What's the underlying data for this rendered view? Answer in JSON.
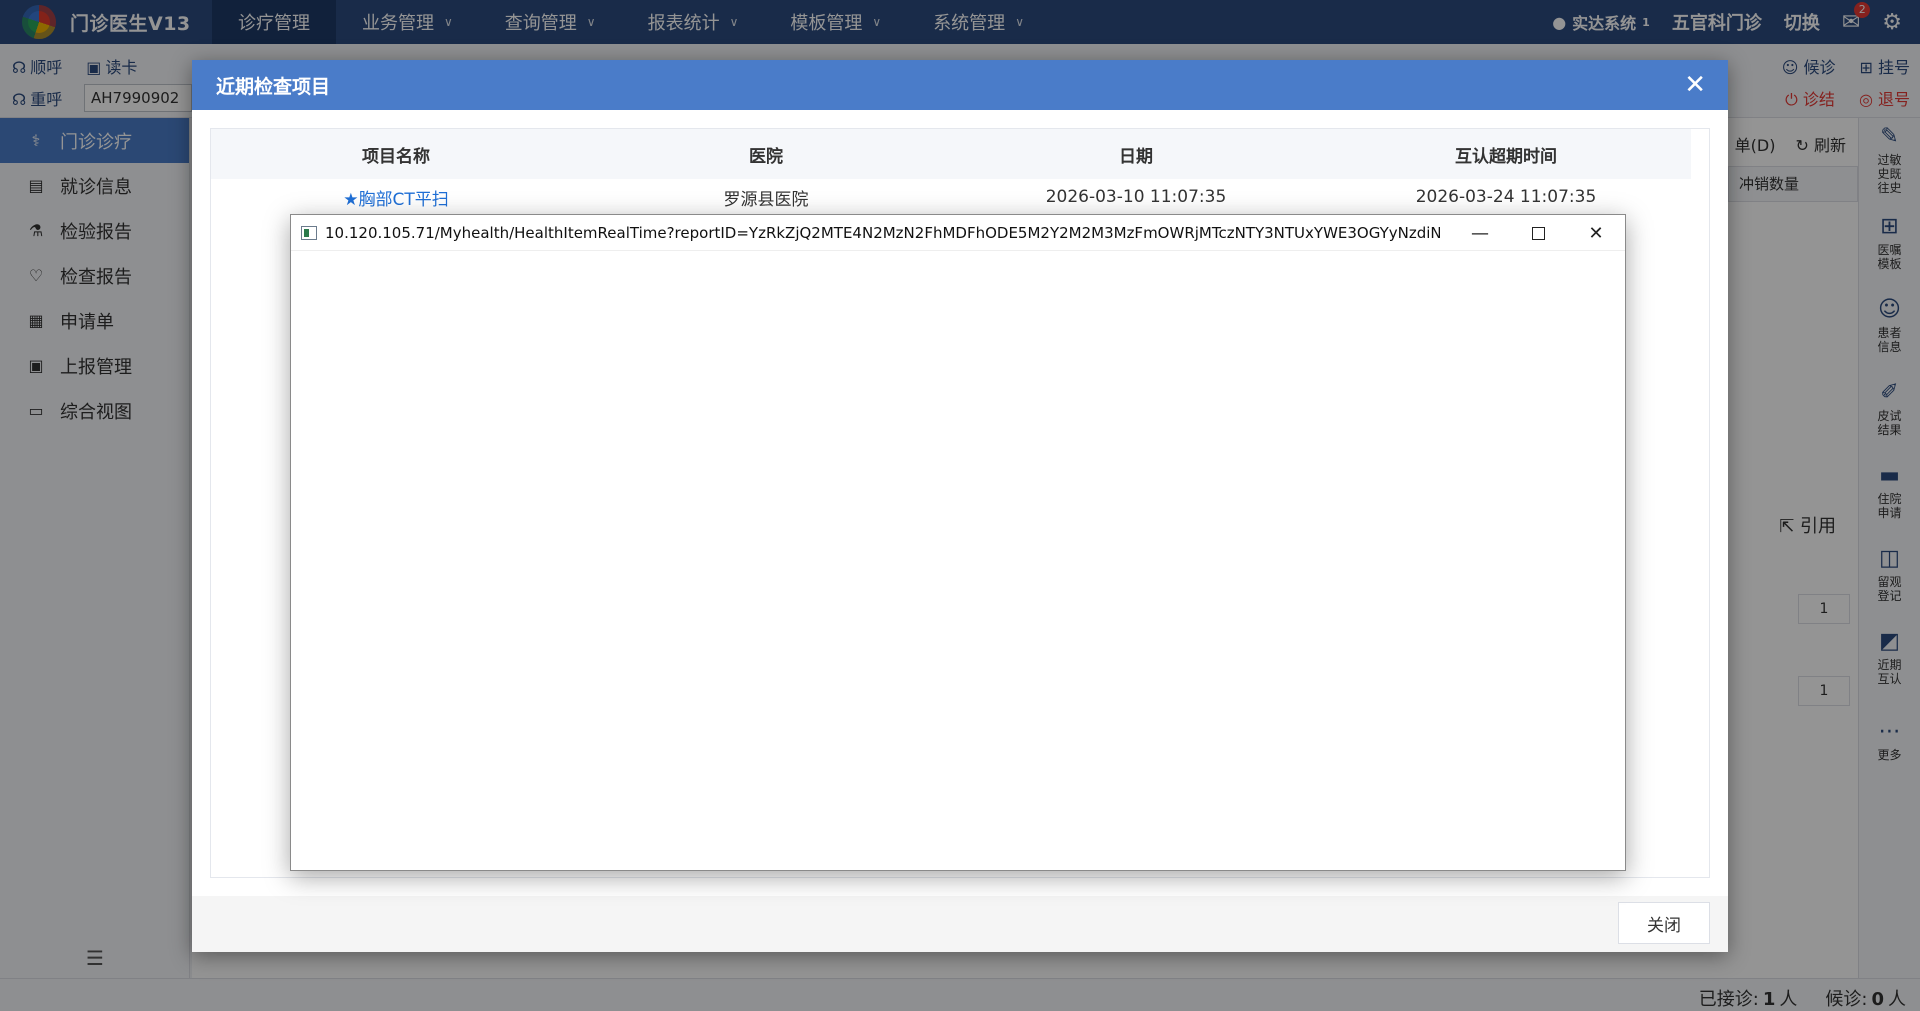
{
  "app": {
    "title": "门诊医生V13",
    "nav": [
      {
        "label": "诊疗管理",
        "active": true,
        "has_menu": false
      },
      {
        "label": "业务管理",
        "active": false,
        "has_menu": true
      },
      {
        "label": "查询管理",
        "active": false,
        "has_menu": true
      },
      {
        "label": "报表统计",
        "active": false,
        "has_menu": true
      },
      {
        "label": "模板管理",
        "active": false,
        "has_menu": true
      },
      {
        "label": "系统管理",
        "active": false,
        "has_menu": true
      }
    ],
    "user": "实达系统",
    "user_sub": "1",
    "department": "五官科门诊",
    "switch_label": "切换",
    "mail_count": "2"
  },
  "toolbar": {
    "call_label": "顺呼",
    "read_card_label": "读卡",
    "recall_label": "重呼",
    "patient_id": "AH7990902",
    "wait_label": "候诊",
    "register_label": "挂号",
    "finish_label": "诊结",
    "refund_label": "退号"
  },
  "sidebar": {
    "items": [
      {
        "label": "门诊诊疗",
        "icon": "stethoscope-icon",
        "glyph": "⚕",
        "active": true
      },
      {
        "label": "就诊信息",
        "icon": "id-card-icon",
        "glyph": "▤",
        "active": false
      },
      {
        "label": "检验报告",
        "icon": "flask-icon",
        "glyph": "⚗",
        "active": false
      },
      {
        "label": "检查报告",
        "icon": "heart-pulse-icon",
        "glyph": "♡",
        "active": false
      },
      {
        "label": "申请单",
        "icon": "form-icon",
        "glyph": "▦",
        "active": false
      },
      {
        "label": "上报管理",
        "icon": "clipboard-icon",
        "glyph": "▣",
        "active": false
      },
      {
        "label": "综合视图",
        "icon": "dashboard-icon",
        "glyph": "▭",
        "active": false
      }
    ]
  },
  "right_sidebar": {
    "items": [
      {
        "label": "过敏史既往史",
        "icon": "capsule-icon",
        "glyph": "✎"
      },
      {
        "label": "医嘱模板",
        "icon": "template-icon",
        "glyph": "⊞"
      },
      {
        "label": "患者信息",
        "icon": "patient-icon",
        "glyph": "☺"
      },
      {
        "label": "皮试结果",
        "icon": "syringe-icon",
        "glyph": "✐"
      },
      {
        "label": "住院申请",
        "icon": "bed-icon",
        "glyph": "▬"
      },
      {
        "label": "留观登记",
        "icon": "observe-icon",
        "glyph": "◫"
      },
      {
        "label": "近期互认",
        "icon": "chart-doc-icon",
        "glyph": "◩"
      },
      {
        "label": "更多",
        "icon": "more-icon",
        "glyph": "⋯"
      }
    ]
  },
  "background": {
    "print_label": "单(D)",
    "refresh_label": "刷新",
    "col_header": "冲销数量",
    "cite_label": "引用",
    "cell_values": [
      "1",
      "1"
    ]
  },
  "status": {
    "received_label": "已接诊:",
    "received_count": "1",
    "waiting_label": "候诊:",
    "waiting_count": "0",
    "unit": "人"
  },
  "modal": {
    "title": "近期检查项目",
    "columns": [
      "项目名称",
      "医院",
      "日期",
      "互认超期时间"
    ],
    "rows": [
      {
        "name": "★胸部CT平扫",
        "hospital": "罗源县医院",
        "date": "2026-03-10 11:07:35",
        "expire": "2026-03-24 11:07:35"
      }
    ],
    "close_button": "关闭"
  },
  "popup": {
    "url": "10.120.105.71/Myhealth/HealthItemRealTime?reportID=YzRkZjQ2MTE4N2MzN2FhMDFhODE5M2Y2M2M3MzFmOWRjMTczNTY3NTUxYWE3OGYyNzdiN..."
  }
}
